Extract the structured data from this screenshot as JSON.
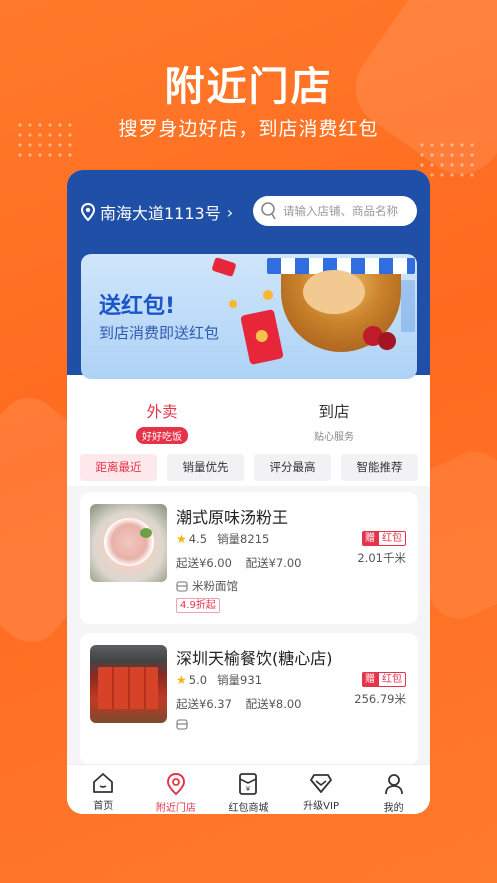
{
  "hero": {
    "title": "附近门店",
    "subtitle": "搜罗身边好店，到店消费红包"
  },
  "location": {
    "address": "南海大道1113号",
    "arrow": "›"
  },
  "search": {
    "placeholder": "请输入店铺、商品名称"
  },
  "banner": {
    "title": "送红包!",
    "subtitle": "到店消费即送红包"
  },
  "tabs": [
    {
      "label": "外卖",
      "sub": "好好吃饭"
    },
    {
      "label": "到店",
      "sub": "贴心服务"
    }
  ],
  "filters": [
    "距离最近",
    "销量优先",
    "评分最高",
    "智能推荐"
  ],
  "stores": [
    {
      "name": "潮式原味汤粉王",
      "rating": "4.5",
      "sales": "销量8215",
      "min_order": "起送¥6.00",
      "delivery_fee": "配送¥7.00",
      "gift_tag": "赠",
      "red_tag": "红包",
      "distance": "2.01千米",
      "category": "米粉面馆",
      "discount": "4.9折起"
    },
    {
      "name": "深圳天榆餐饮(糖心店)",
      "rating": "5.0",
      "sales": "销量931",
      "min_order": "起送¥6.37",
      "delivery_fee": "配送¥8.00",
      "gift_tag": "赠",
      "red_tag": "红包",
      "distance": "256.79米"
    }
  ],
  "tabbar": [
    {
      "label": "首页",
      "icon": "home-icon"
    },
    {
      "label": "附近门店",
      "icon": "location-pin-icon"
    },
    {
      "label": "红包商城",
      "icon": "red-envelope-icon"
    },
    {
      "label": "升级VIP",
      "icon": "diamond-icon"
    },
    {
      "label": "我的",
      "icon": "user-icon"
    }
  ],
  "colors": {
    "background": "#ff6a1f",
    "header_blue": "#1f4fa6",
    "accent_red": "#e5344a"
  }
}
